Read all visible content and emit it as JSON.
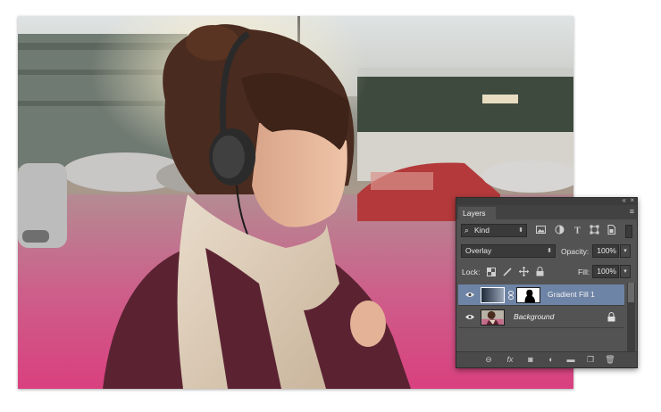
{
  "photo": {
    "description_name": "woman-with-headphones-photo"
  },
  "layers_panel": {
    "collapse_glyph": "«",
    "close_glyph": "×",
    "tab_label": "Layers",
    "menu_glyph": "≡",
    "filter": {
      "search_glyph": "⌕",
      "kind_label": "Kind",
      "icons": [
        "image-filter-icon",
        "adjustment-filter-icon",
        "type-filter-icon",
        "shape-filter-icon",
        "smart-object-filter-icon"
      ]
    },
    "blend_mode": "Overlay",
    "opacity_label": "Opacity:",
    "opacity_value": "100%",
    "lock_label": "Lock:",
    "fill_label": "Fill:",
    "fill_value": "100%",
    "layers": [
      {
        "name": "Gradient Fill 1",
        "visible": true,
        "selected": true,
        "italic": false
      },
      {
        "name": "Background",
        "visible": true,
        "selected": false,
        "italic": true,
        "locked": true
      }
    ],
    "footer_icons": [
      "link-layers-icon",
      "fx-icon",
      "add-mask-icon",
      "adjustment-layer-icon",
      "new-group-icon",
      "new-layer-icon",
      "delete-layer-icon"
    ],
    "footer_glyphs": {
      "link": "⊖",
      "fx": "fx",
      "mask": "◙",
      "adjust": "◐",
      "group": "▬",
      "new": "❐",
      "delete": "🗑"
    },
    "colors": {
      "panel_bg": "#535353",
      "selection": "#6e84a6"
    }
  }
}
